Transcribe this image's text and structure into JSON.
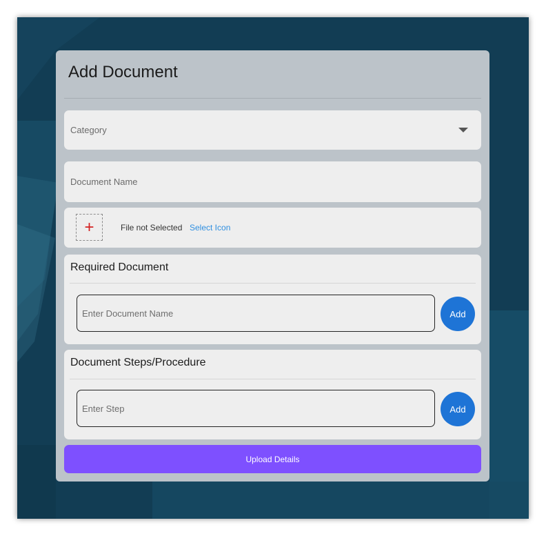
{
  "dialog": {
    "title": "Add Document"
  },
  "category": {
    "placeholder": "Category"
  },
  "document_name": {
    "placeholder": "Document Name"
  },
  "icon_picker": {
    "status": "File not Selected",
    "link_label": "Select Icon",
    "add_glyph": "+"
  },
  "required_document": {
    "title": "Required Document",
    "input_placeholder": "Enter Document Name",
    "add_label": "Add"
  },
  "document_steps": {
    "title": "Document Steps/Procedure",
    "input_placeholder": "Enter Step",
    "add_label": "Add"
  },
  "upload": {
    "label": "Upload Details"
  },
  "colors": {
    "accent_blue": "#1e74d6",
    "upload_purple": "#7e50ff",
    "link_blue": "#2f8fe0",
    "plus_red": "#d32020",
    "background": "#123d54"
  }
}
